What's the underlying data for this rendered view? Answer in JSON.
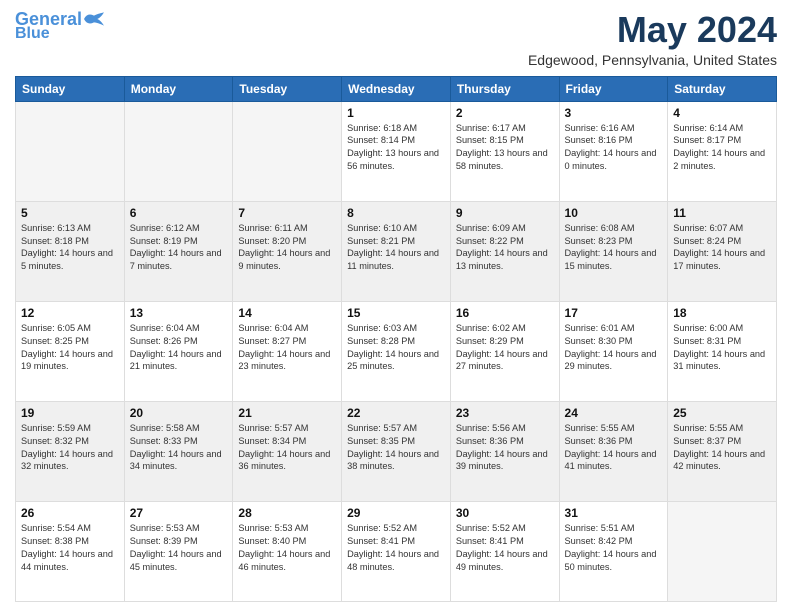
{
  "logo": {
    "line1": "General",
    "line2": "Blue"
  },
  "title": "May 2024",
  "subtitle": "Edgewood, Pennsylvania, United States",
  "days_of_week": [
    "Sunday",
    "Monday",
    "Tuesday",
    "Wednesday",
    "Thursday",
    "Friday",
    "Saturday"
  ],
  "weeks": [
    [
      {
        "day": "",
        "empty": true
      },
      {
        "day": "",
        "empty": true
      },
      {
        "day": "",
        "empty": true
      },
      {
        "day": "1",
        "sunrise": "6:18 AM",
        "sunset": "8:14 PM",
        "daylight": "13 hours and 56 minutes."
      },
      {
        "day": "2",
        "sunrise": "6:17 AM",
        "sunset": "8:15 PM",
        "daylight": "13 hours and 58 minutes."
      },
      {
        "day": "3",
        "sunrise": "6:16 AM",
        "sunset": "8:16 PM",
        "daylight": "14 hours and 0 minutes."
      },
      {
        "day": "4",
        "sunrise": "6:14 AM",
        "sunset": "8:17 PM",
        "daylight": "14 hours and 2 minutes."
      }
    ],
    [
      {
        "day": "5",
        "sunrise": "6:13 AM",
        "sunset": "8:18 PM",
        "daylight": "14 hours and 5 minutes."
      },
      {
        "day": "6",
        "sunrise": "6:12 AM",
        "sunset": "8:19 PM",
        "daylight": "14 hours and 7 minutes."
      },
      {
        "day": "7",
        "sunrise": "6:11 AM",
        "sunset": "8:20 PM",
        "daylight": "14 hours and 9 minutes."
      },
      {
        "day": "8",
        "sunrise": "6:10 AM",
        "sunset": "8:21 PM",
        "daylight": "14 hours and 11 minutes."
      },
      {
        "day": "9",
        "sunrise": "6:09 AM",
        "sunset": "8:22 PM",
        "daylight": "14 hours and 13 minutes."
      },
      {
        "day": "10",
        "sunrise": "6:08 AM",
        "sunset": "8:23 PM",
        "daylight": "14 hours and 15 minutes."
      },
      {
        "day": "11",
        "sunrise": "6:07 AM",
        "sunset": "8:24 PM",
        "daylight": "14 hours and 17 minutes."
      }
    ],
    [
      {
        "day": "12",
        "sunrise": "6:05 AM",
        "sunset": "8:25 PM",
        "daylight": "14 hours and 19 minutes."
      },
      {
        "day": "13",
        "sunrise": "6:04 AM",
        "sunset": "8:26 PM",
        "daylight": "14 hours and 21 minutes."
      },
      {
        "day": "14",
        "sunrise": "6:04 AM",
        "sunset": "8:27 PM",
        "daylight": "14 hours and 23 minutes."
      },
      {
        "day": "15",
        "sunrise": "6:03 AM",
        "sunset": "8:28 PM",
        "daylight": "14 hours and 25 minutes."
      },
      {
        "day": "16",
        "sunrise": "6:02 AM",
        "sunset": "8:29 PM",
        "daylight": "14 hours and 27 minutes."
      },
      {
        "day": "17",
        "sunrise": "6:01 AM",
        "sunset": "8:30 PM",
        "daylight": "14 hours and 29 minutes."
      },
      {
        "day": "18",
        "sunrise": "6:00 AM",
        "sunset": "8:31 PM",
        "daylight": "14 hours and 31 minutes."
      }
    ],
    [
      {
        "day": "19",
        "sunrise": "5:59 AM",
        "sunset": "8:32 PM",
        "daylight": "14 hours and 32 minutes."
      },
      {
        "day": "20",
        "sunrise": "5:58 AM",
        "sunset": "8:33 PM",
        "daylight": "14 hours and 34 minutes."
      },
      {
        "day": "21",
        "sunrise": "5:57 AM",
        "sunset": "8:34 PM",
        "daylight": "14 hours and 36 minutes."
      },
      {
        "day": "22",
        "sunrise": "5:57 AM",
        "sunset": "8:35 PM",
        "daylight": "14 hours and 38 minutes."
      },
      {
        "day": "23",
        "sunrise": "5:56 AM",
        "sunset": "8:36 PM",
        "daylight": "14 hours and 39 minutes."
      },
      {
        "day": "24",
        "sunrise": "5:55 AM",
        "sunset": "8:36 PM",
        "daylight": "14 hours and 41 minutes."
      },
      {
        "day": "25",
        "sunrise": "5:55 AM",
        "sunset": "8:37 PM",
        "daylight": "14 hours and 42 minutes."
      }
    ],
    [
      {
        "day": "26",
        "sunrise": "5:54 AM",
        "sunset": "8:38 PM",
        "daylight": "14 hours and 44 minutes."
      },
      {
        "day": "27",
        "sunrise": "5:53 AM",
        "sunset": "8:39 PM",
        "daylight": "14 hours and 45 minutes."
      },
      {
        "day": "28",
        "sunrise": "5:53 AM",
        "sunset": "8:40 PM",
        "daylight": "14 hours and 46 minutes."
      },
      {
        "day": "29",
        "sunrise": "5:52 AM",
        "sunset": "8:41 PM",
        "daylight": "14 hours and 48 minutes."
      },
      {
        "day": "30",
        "sunrise": "5:52 AM",
        "sunset": "8:41 PM",
        "daylight": "14 hours and 49 minutes."
      },
      {
        "day": "31",
        "sunrise": "5:51 AM",
        "sunset": "8:42 PM",
        "daylight": "14 hours and 50 minutes."
      },
      {
        "day": "",
        "empty": true
      }
    ]
  ],
  "labels": {
    "sunrise_prefix": "Sunrise: ",
    "sunset_prefix": "Sunset: ",
    "daylight_prefix": "Daylight: "
  }
}
